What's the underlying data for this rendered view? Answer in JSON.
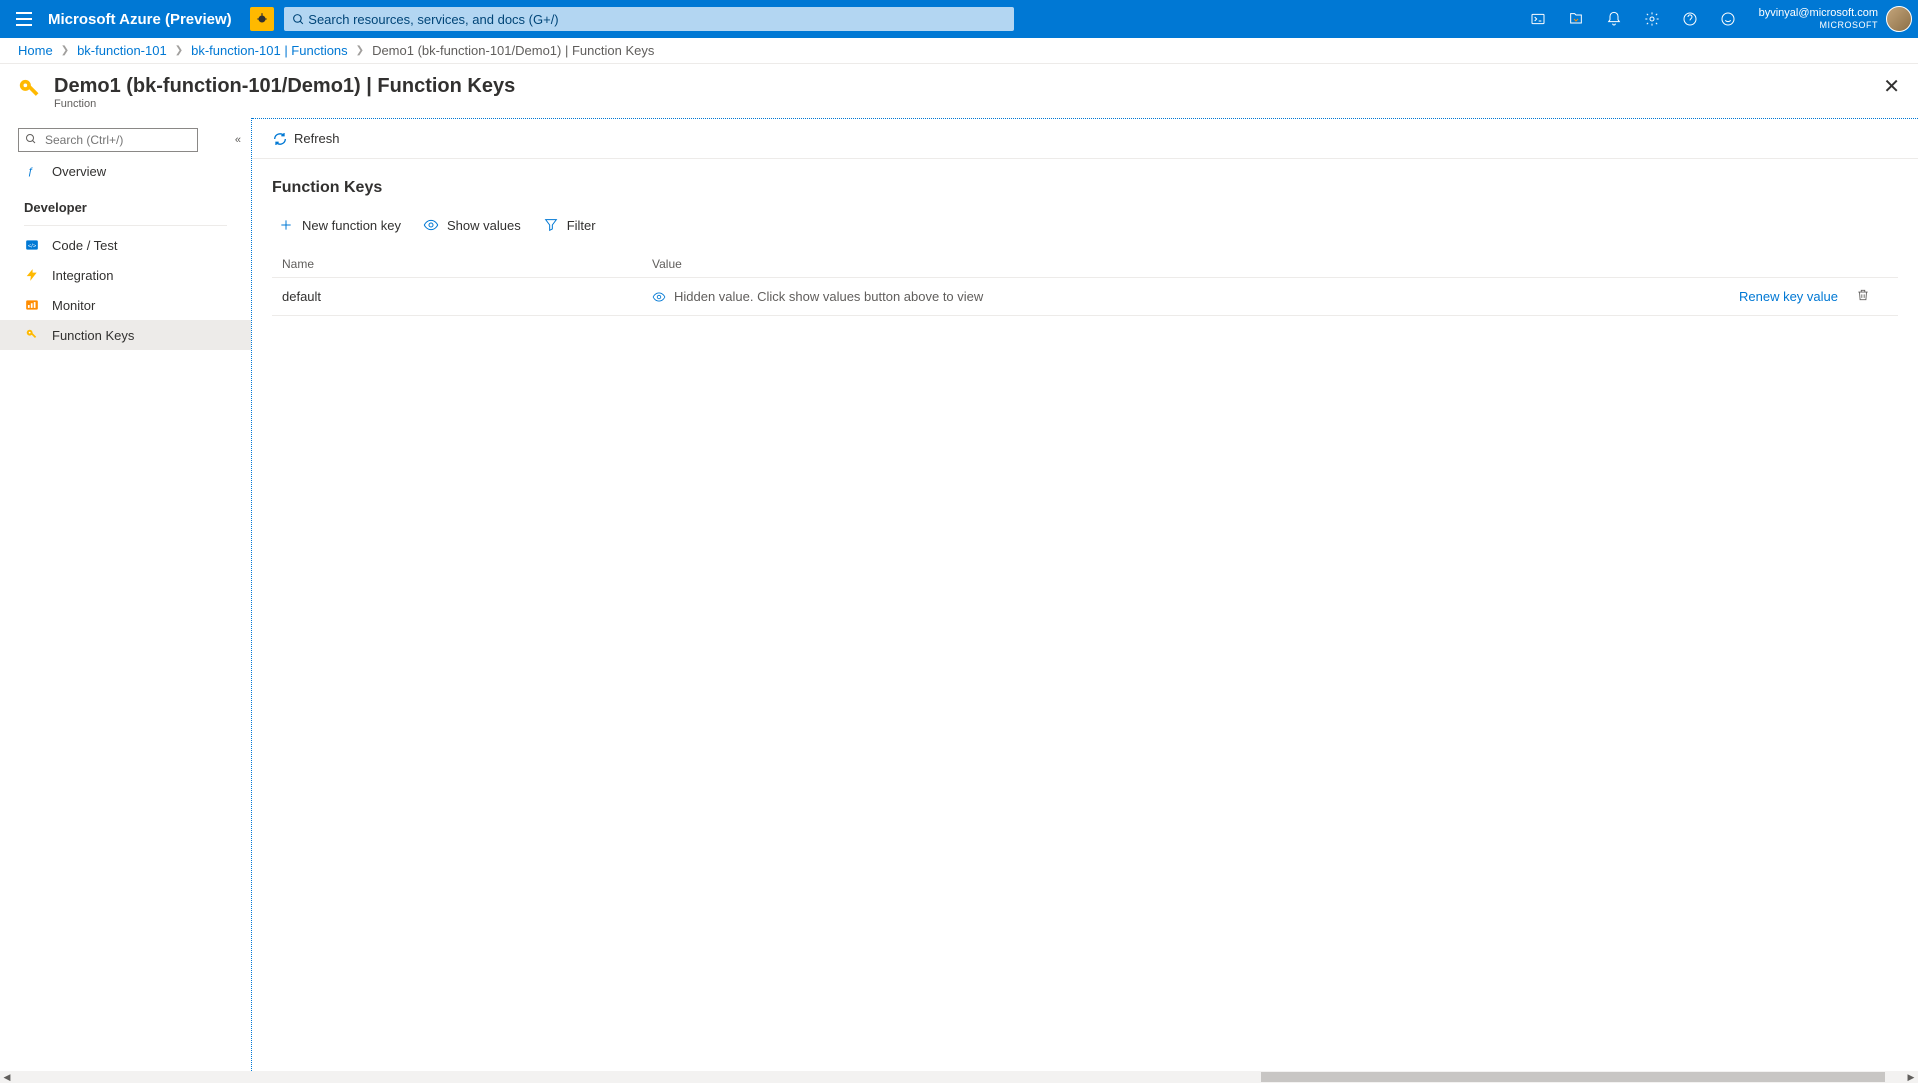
{
  "header": {
    "brand": "Microsoft Azure (Preview)",
    "search_placeholder": "Search resources, services, and docs (G+/)",
    "account_email": "byvinyal@microsoft.com",
    "account_org": "MICROSOFT"
  },
  "breadcrumb": {
    "items": [
      "Home",
      "bk-function-101",
      "bk-function-101 | Functions"
    ],
    "current": "Demo1 (bk-function-101/Demo1) | Function Keys"
  },
  "blade": {
    "title": "Demo1 (bk-function-101/Demo1) | Function Keys",
    "subtitle": "Function"
  },
  "sidebar": {
    "search_placeholder": "Search (Ctrl+/)",
    "overview": "Overview",
    "group_developer": "Developer",
    "items": [
      {
        "label": "Code / Test"
      },
      {
        "label": "Integration"
      },
      {
        "label": "Monitor"
      },
      {
        "label": "Function Keys"
      }
    ]
  },
  "commandbar": {
    "refresh": "Refresh"
  },
  "content": {
    "section_title": "Function Keys",
    "actions": {
      "new_key": "New function key",
      "show_values": "Show values",
      "filter": "Filter"
    },
    "table": {
      "col_name": "Name",
      "col_value": "Value",
      "rows": [
        {
          "name": "default",
          "value_text": "Hidden value. Click show values button above to view",
          "renew": "Renew key value"
        }
      ]
    }
  }
}
